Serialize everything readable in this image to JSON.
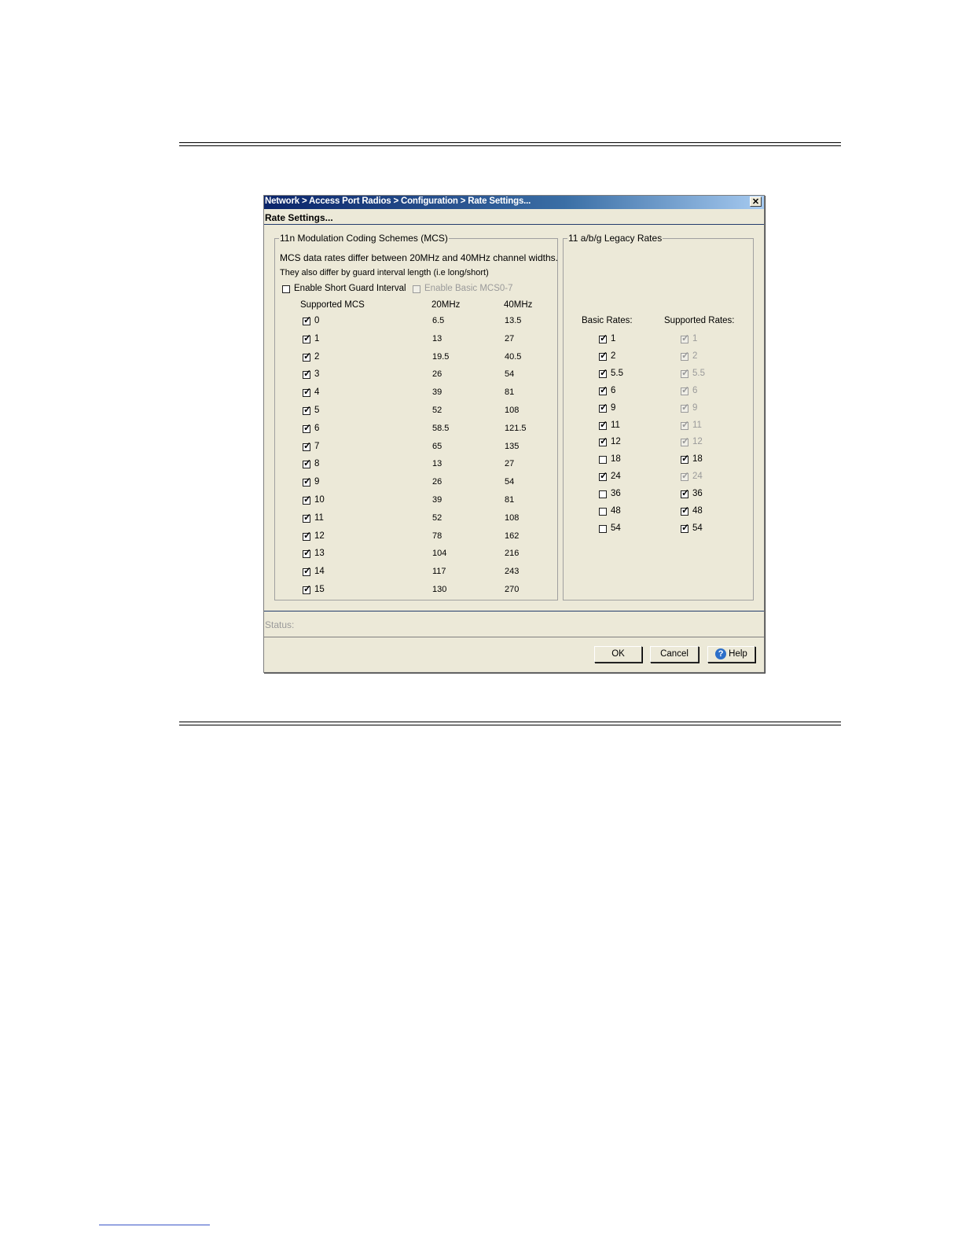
{
  "window": {
    "title": "Network > Access Port Radios > Configuration > Rate Settings...",
    "subtitle": "Rate Settings..."
  },
  "mcs": {
    "legend": "11n Modulation Coding Schemes (MCS)",
    "desc1": "MCS data rates differ between 20MHz and 40MHz channel widths.",
    "desc2": "They also differ by guard interval length (i.e long/short)",
    "short_guard": {
      "label": "Enable Short Guard Interval",
      "checked": false
    },
    "basic_mcs": {
      "label": "Enable Basic MCS0-7",
      "checked": false,
      "disabled": true
    },
    "headers": {
      "supported": "Supported MCS",
      "mhz20": "20MHz",
      "mhz40": "40MHz"
    },
    "rows": [
      {
        "mcs": "0",
        "r20": "6.5",
        "r40": "13.5",
        "checked": true
      },
      {
        "mcs": "1",
        "r20": "13",
        "r40": "27",
        "checked": true
      },
      {
        "mcs": "2",
        "r20": "19.5",
        "r40": "40.5",
        "checked": true
      },
      {
        "mcs": "3",
        "r20": "26",
        "r40": "54",
        "checked": true
      },
      {
        "mcs": "4",
        "r20": "39",
        "r40": "81",
        "checked": true
      },
      {
        "mcs": "5",
        "r20": "52",
        "r40": "108",
        "checked": true
      },
      {
        "mcs": "6",
        "r20": "58.5",
        "r40": "121.5",
        "checked": true
      },
      {
        "mcs": "7",
        "r20": "65",
        "r40": "135",
        "checked": true
      },
      {
        "mcs": "8",
        "r20": "13",
        "r40": "27",
        "checked": true
      },
      {
        "mcs": "9",
        "r20": "26",
        "r40": "54",
        "checked": true
      },
      {
        "mcs": "10",
        "r20": "39",
        "r40": "81",
        "checked": true
      },
      {
        "mcs": "11",
        "r20": "52",
        "r40": "108",
        "checked": true
      },
      {
        "mcs": "12",
        "r20": "78",
        "r40": "162",
        "checked": true
      },
      {
        "mcs": "13",
        "r20": "104",
        "r40": "216",
        "checked": true
      },
      {
        "mcs": "14",
        "r20": "117",
        "r40": "243",
        "checked": true
      },
      {
        "mcs": "15",
        "r20": "130",
        "r40": "270",
        "checked": true
      }
    ]
  },
  "legacy": {
    "legend": "11 a/b/g Legacy Rates",
    "basic_header": "Basic Rates:",
    "supported_header": "Supported Rates:",
    "rows": [
      {
        "rate": "1",
        "basic": true,
        "supported": true,
        "sup_disabled": true
      },
      {
        "rate": "2",
        "basic": true,
        "supported": true,
        "sup_disabled": true
      },
      {
        "rate": "5.5",
        "basic": true,
        "supported": true,
        "sup_disabled": true
      },
      {
        "rate": "6",
        "basic": true,
        "supported": true,
        "sup_disabled": true
      },
      {
        "rate": "9",
        "basic": true,
        "supported": true,
        "sup_disabled": true
      },
      {
        "rate": "11",
        "basic": true,
        "supported": true,
        "sup_disabled": true
      },
      {
        "rate": "12",
        "basic": true,
        "supported": true,
        "sup_disabled": true
      },
      {
        "rate": "18",
        "basic": false,
        "supported": true,
        "sup_disabled": false
      },
      {
        "rate": "24",
        "basic": true,
        "supported": true,
        "sup_disabled": true
      },
      {
        "rate": "36",
        "basic": false,
        "supported": true,
        "sup_disabled": false
      },
      {
        "rate": "48",
        "basic": false,
        "supported": true,
        "sup_disabled": false
      },
      {
        "rate": "54",
        "basic": false,
        "supported": true,
        "sup_disabled": false
      }
    ]
  },
  "status": {
    "label": "Status:"
  },
  "buttons": {
    "ok": "OK",
    "cancel": "Cancel",
    "help": "Help"
  },
  "icons": {
    "close": "close-icon",
    "help": "help-icon",
    "check": "check-icon"
  },
  "colors": {
    "titlebar": "#0a246a",
    "dialog_bg": "#ece9d8",
    "disabled_text": "#9a9a9a"
  }
}
